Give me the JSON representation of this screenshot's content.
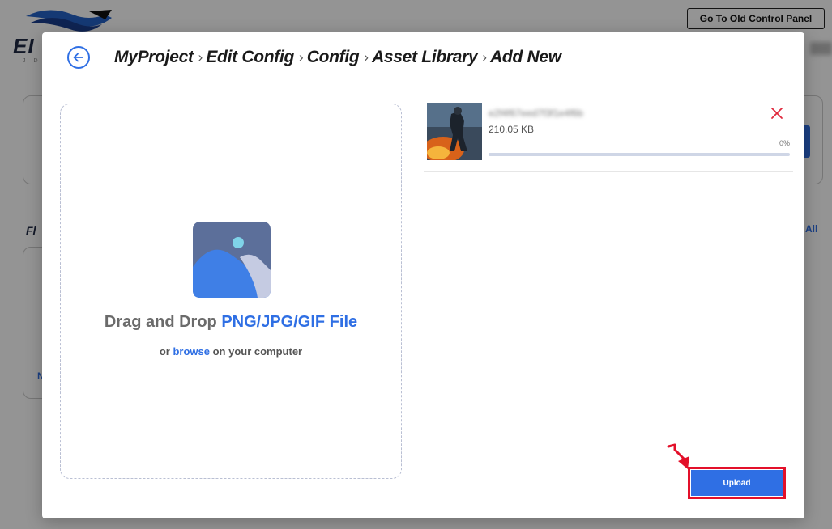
{
  "background": {
    "brand": "EI",
    "brand_sub": "J D",
    "old_panel_button": "Go To Old Control Panel",
    "section_title": "Fl",
    "view_all": "All",
    "link_letter": "N"
  },
  "modal": {
    "breadcrumb": [
      "MyProject",
      "Edit Config",
      "Config",
      "Asset Library",
      "Add New"
    ],
    "drop_zone": {
      "title_prefix": "Drag and Drop ",
      "title_highlight": "PNG/JPG/GIF File",
      "sub_prefix": "or ",
      "browse_link": "browse",
      "sub_suffix": " on your computer"
    },
    "file": {
      "name": "e2f4f67eed7f3f1e4f6b",
      "size": "210.05 KB",
      "progress_label": "0%",
      "progress": 0
    },
    "upload_button": "Upload"
  },
  "colors": {
    "accent": "#2f6fe4",
    "remove": "#e0293d",
    "highlight_box": "#e3102a"
  },
  "icons": {
    "back": "back-arrow-circle-icon",
    "remove": "close-x-icon",
    "image_placeholder": "image-icon"
  }
}
